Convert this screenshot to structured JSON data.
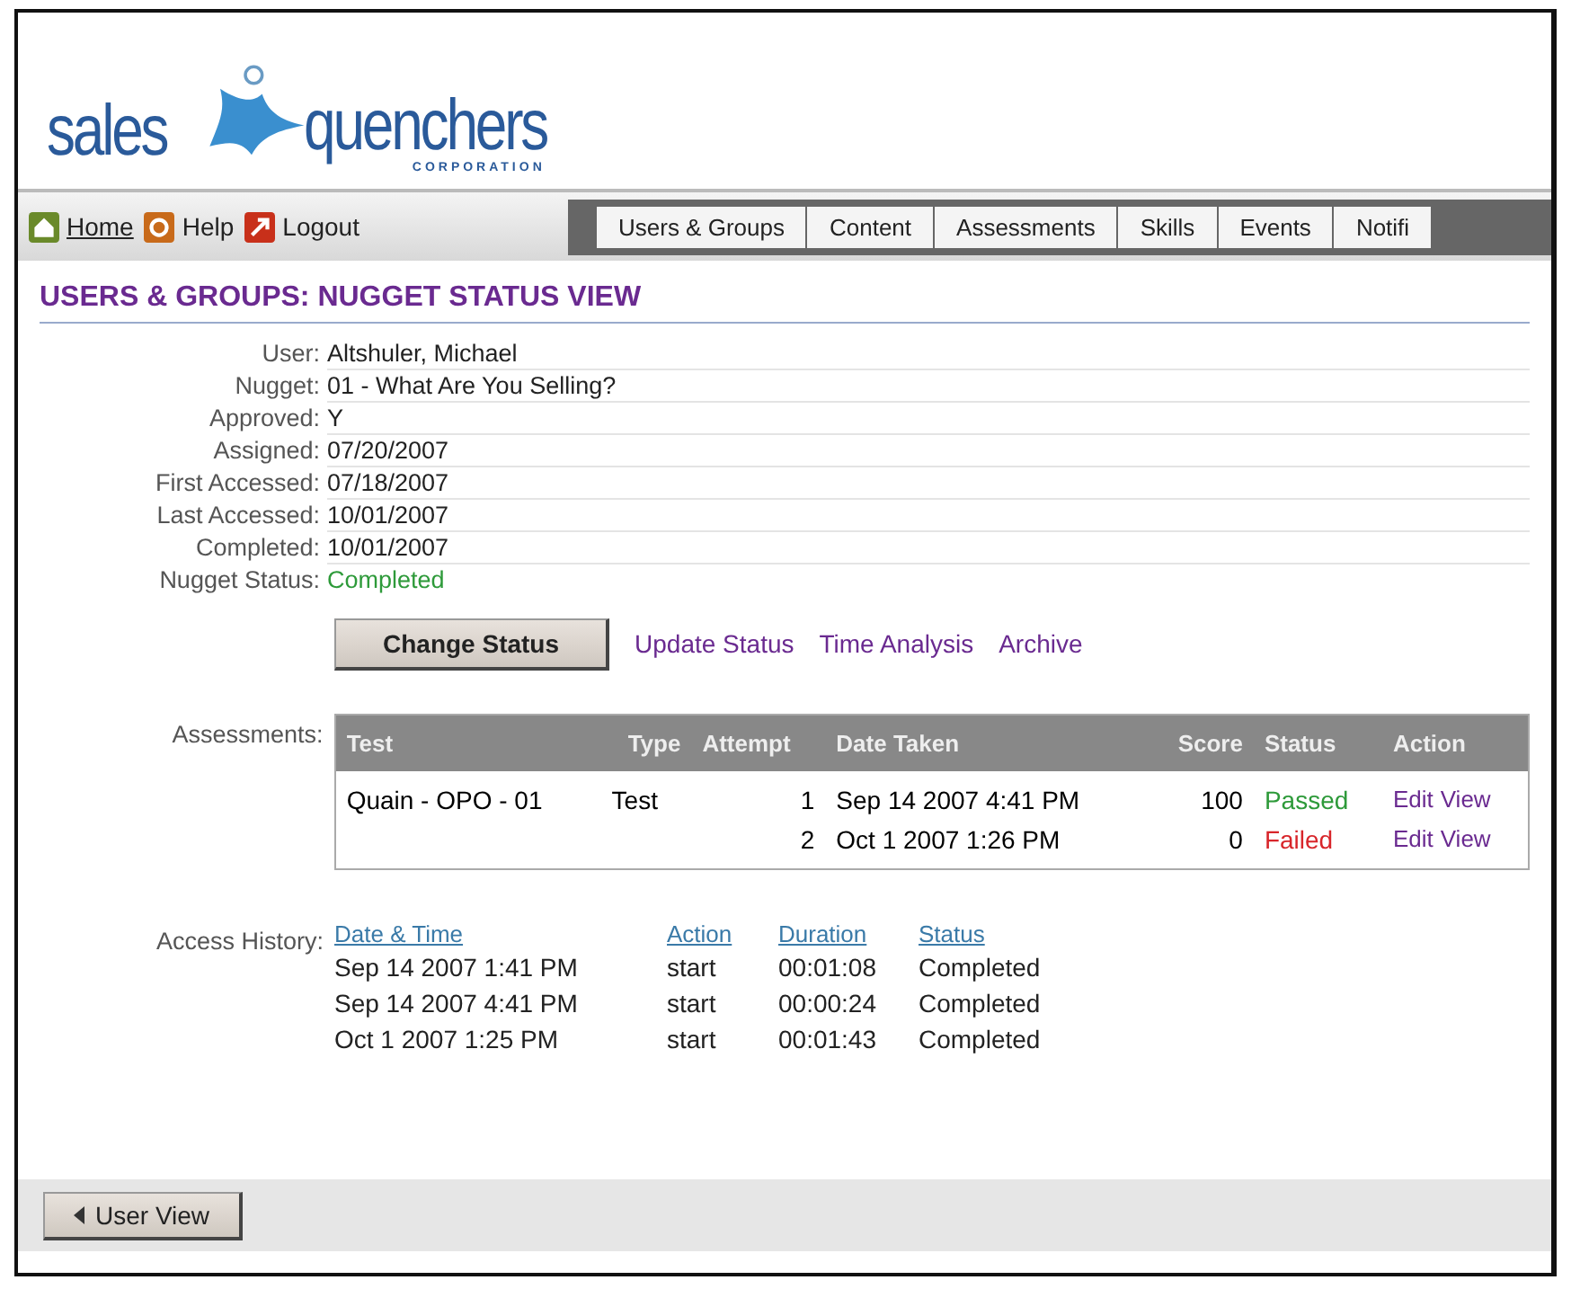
{
  "logo": {
    "word_left": "sales",
    "word_right": "quenchers",
    "subtitle": "CORPORATION"
  },
  "nav_links": [
    {
      "label": "Home"
    },
    {
      "label": "Help"
    },
    {
      "label": "Logout"
    }
  ],
  "tabs": [
    "Users & Groups",
    "Content",
    "Assessments",
    "Skills",
    "Events",
    "Notifi"
  ],
  "page_title": "USERS & GROUPS: NUGGET STATUS VIEW",
  "fields": [
    {
      "label": "User:",
      "value": "Altshuler, Michael",
      "kind": "text"
    },
    {
      "label": "Nugget:",
      "value": "01 - What Are You Selling?",
      "kind": "text"
    },
    {
      "label": "Approved:",
      "value": "Y",
      "kind": "text"
    },
    {
      "label": "Assigned:",
      "value": "07/20/2007",
      "kind": "text"
    },
    {
      "label": "First Accessed:",
      "value": "07/18/2007",
      "kind": "text"
    },
    {
      "label": "Last Accessed:",
      "value": "10/01/2007",
      "kind": "text"
    },
    {
      "label": "Completed:",
      "value": "10/01/2007",
      "kind": "text"
    },
    {
      "label": "Nugget Status:",
      "value": "Completed",
      "kind": "status"
    }
  ],
  "change_status_button": "Change Status",
  "action_links": [
    "Update Status",
    "Time Analysis",
    "Archive"
  ],
  "assessments": {
    "label": "Assessments:",
    "columns": [
      "Test",
      "Type",
      "Attempt",
      "Date Taken",
      "Score",
      "Status",
      "Action"
    ],
    "rows": [
      {
        "test": "Quain - OPO - 01",
        "type": "Test",
        "attempt": "1",
        "date": "Sep 14 2007 4:41 PM",
        "score": "100",
        "status": "Passed",
        "color": "#2e9a3a",
        "actions": [
          "Edit",
          "View"
        ]
      },
      {
        "attempt": "2",
        "date": "Oct 1 2007 1:26 PM",
        "score": "0",
        "status": "Failed",
        "color": "#d8262b",
        "actions": [
          "Edit",
          "View"
        ]
      }
    ]
  },
  "access_history": {
    "label": "Access History:",
    "columns": [
      "Date & Time",
      "Action",
      "Duration",
      "Status"
    ],
    "rows": [
      [
        "Sep 14 2007 1:41 PM",
        "start",
        "00:01:08",
        "Completed"
      ],
      [
        "Sep 14 2007 4:41 PM",
        "start",
        "00:00:24",
        "Completed"
      ],
      [
        "Oct 1 2007 1:25 PM",
        "start",
        "00:01:43",
        "Completed"
      ]
    ]
  },
  "user_view_button": "User View"
}
